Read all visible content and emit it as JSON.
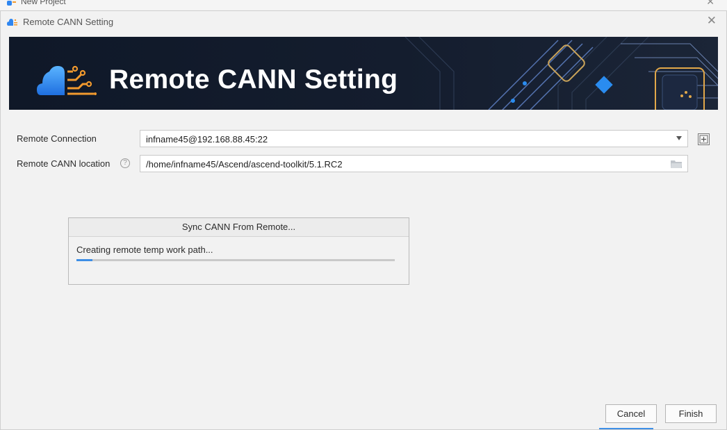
{
  "parent_window": {
    "title": "New Project",
    "close_glyph": "✕"
  },
  "dialog": {
    "title": "Remote CANN Setting",
    "close_glyph": "✕",
    "banner_title": "Remote CANN Setting"
  },
  "form": {
    "remote_connection": {
      "label": "Remote Connection",
      "value": "infname45@192.168.88.45:22"
    },
    "cann_location": {
      "label": "Remote CANN location",
      "help_glyph": "?",
      "value": "/home/infname45/Ascend/ascend-toolkit/5.1.RC2"
    }
  },
  "sync": {
    "title": "Sync CANN From Remote...",
    "status": "Creating remote temp work path...",
    "progress": 0.05
  },
  "buttons": {
    "cancel": "Cancel",
    "finish": "Finish"
  },
  "colors": {
    "accent": "#3d8ee6",
    "banner_bg": "#141d2e",
    "logo_blue": "#2f86f0",
    "logo_orange": "#f29a2e"
  },
  "icons": [
    "app-logo-icon",
    "close-icon",
    "dropdown-arrow-icon",
    "add-icon",
    "help-icon",
    "folder-icon"
  ]
}
